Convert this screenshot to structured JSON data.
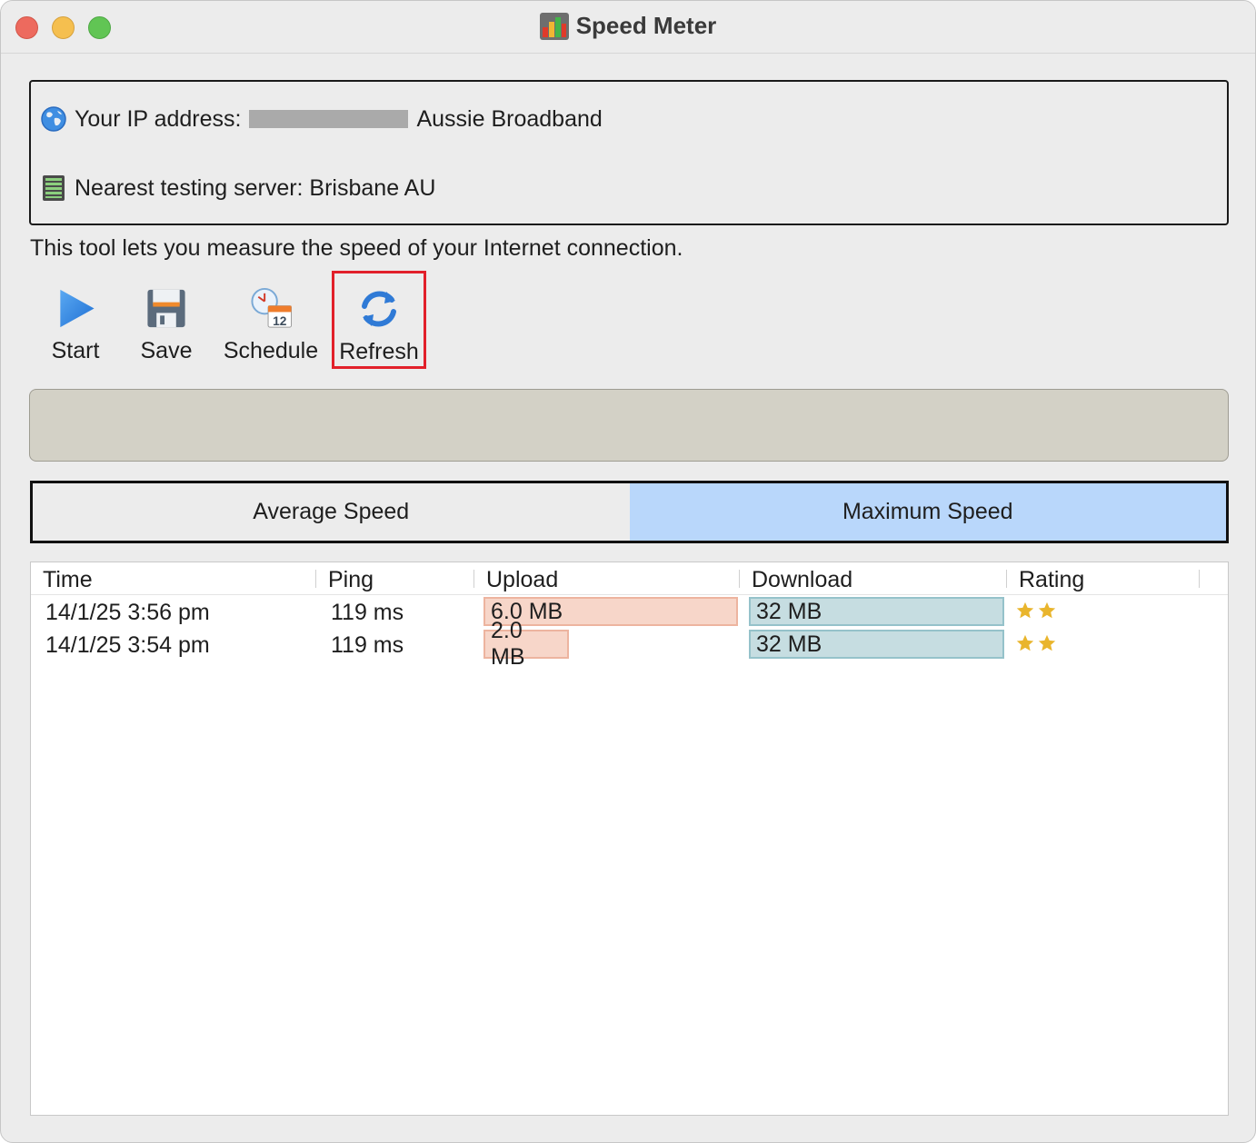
{
  "window": {
    "title": "Speed Meter"
  },
  "info": {
    "ip_label": "Your IP address:",
    "isp": "Aussie Broadband",
    "server_label": "Nearest testing server: Brisbane AU"
  },
  "description": "This tool lets you measure the speed of your Internet connection.",
  "toolbar": {
    "start_label": "Start",
    "save_label": "Save",
    "schedule_label": "Schedule",
    "schedule_icon_day": "12",
    "refresh_label": "Refresh"
  },
  "tabs": [
    {
      "label": "Average Speed",
      "active": false
    },
    {
      "label": "Maximum Speed",
      "active": true
    }
  ],
  "table": {
    "columns": [
      "Time",
      "Ping",
      "Upload",
      "Download",
      "Rating"
    ],
    "rows": [
      {
        "time": "14/1/25 3:56 pm",
        "ping": "119 ms",
        "upload": "6.0 MB",
        "download": "32 MB",
        "rating": 2,
        "upload_fraction": 1.0,
        "download_fraction": 1.0
      },
      {
        "time": "14/1/25 3:54 pm",
        "ping": "119 ms",
        "upload": "2.0 MB",
        "download": "32 MB",
        "rating": 2,
        "upload_fraction": 0.333,
        "download_fraction": 1.0
      }
    ]
  },
  "colors": {
    "active_tab": "#b9d7fb",
    "upload_bar": "#f7d6c9",
    "download_bar": "#c6dde1",
    "highlight_box": "#e2202a",
    "star": "#e9b52d"
  },
  "icons": {
    "ip": "globe-icon",
    "server": "server-icon",
    "start": "play-icon",
    "save": "floppy-disk-icon",
    "schedule": "clock-calendar-icon",
    "refresh": "refresh-icon",
    "rating": "star-icon"
  }
}
